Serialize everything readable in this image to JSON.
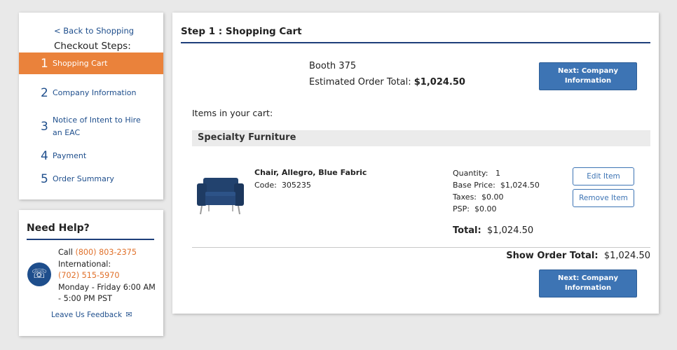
{
  "steps": {
    "back_link": "< Back to Shopping",
    "title": "Checkout Steps:",
    "items": [
      {
        "num": "1",
        "label": "Shopping Cart",
        "active": true
      },
      {
        "num": "2",
        "label": "Company Information",
        "active": false
      },
      {
        "num": "3",
        "label": "Notice of Intent to Hire an EAC",
        "active": false
      },
      {
        "num": "4",
        "label": "Payment",
        "active": false
      },
      {
        "num": "5",
        "label": "Order Summary",
        "active": false
      }
    ]
  },
  "help": {
    "title": "Need Help?",
    "call_prefix": "Call ",
    "phone": "(800) 803-2375",
    "intl_label": "International:",
    "intl_phone": "(702) 515-5970",
    "hours": "Monday - Friday 6:00 AM - 5:00 PM PST",
    "feedback": "Leave Us Feedback",
    "icon": "phone-icon"
  },
  "main": {
    "title": "Step 1 : Shopping Cart",
    "booth": "Booth 375",
    "est_label": "Estimated Order Total: ",
    "est_value": "$1,024.50",
    "next_button": "Next: Company Information",
    "items_label": "Items in your cart:",
    "category": "Specialty Furniture",
    "item": {
      "name": "Chair, Allegro, Blue Fabric",
      "code_label": "Code:",
      "code": "305235",
      "quantity_label": "Quantity:",
      "quantity": "1",
      "base_price_label": "Base Price:",
      "base_price": "$1,024.50",
      "taxes_label": "Taxes:",
      "taxes": "$0.00",
      "psp_label": "PSP:",
      "psp": "$0.00",
      "total_label": "Total:",
      "total": "$1,024.50",
      "edit_button": "Edit Item",
      "remove_button": "Remove Item"
    },
    "show_total_label": "Show Order Total:",
    "show_total_value": "$1,024.50"
  },
  "colors": {
    "accent_orange": "#ea823b",
    "brand_blue": "#1e4e8c",
    "button_blue": "#3d74b4"
  }
}
